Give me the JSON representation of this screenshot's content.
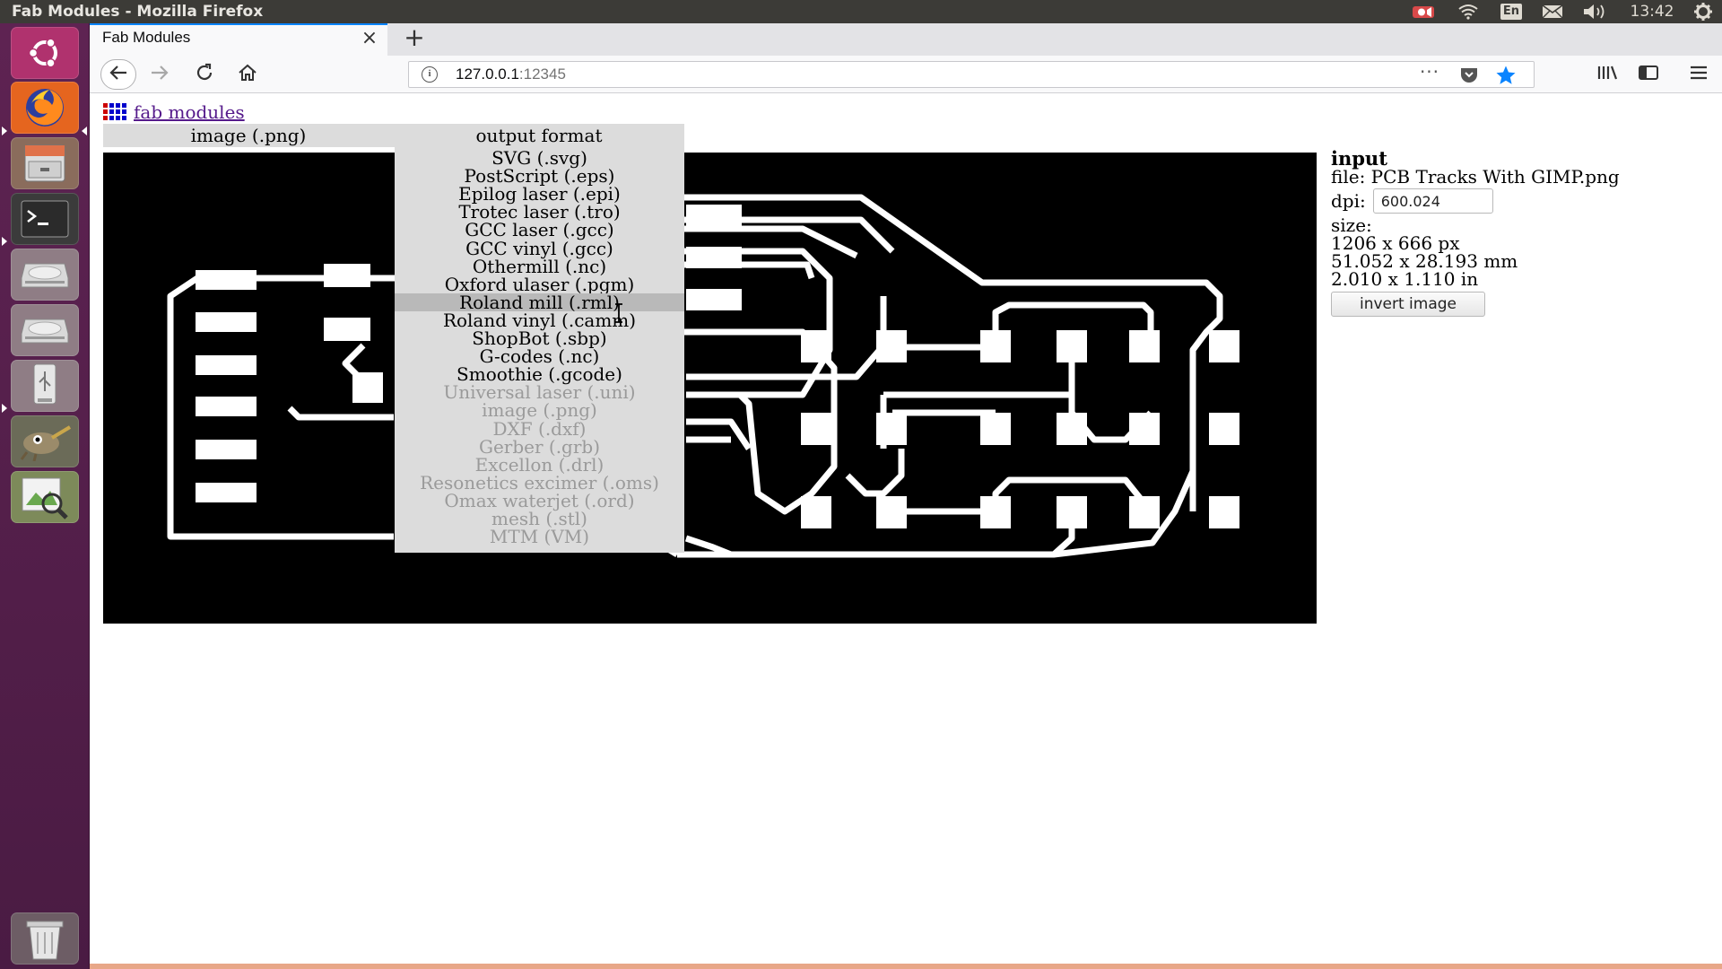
{
  "system": {
    "window_title": "Fab Modules - Mozilla Firefox",
    "keyboard_layout": "En",
    "clock": "13:42"
  },
  "launcher": {
    "items": [
      {
        "name": "ubuntu-dash",
        "icon": "ubuntu-logo-icon"
      },
      {
        "name": "firefox",
        "icon": "firefox-icon"
      },
      {
        "name": "files",
        "icon": "file-cabinet-icon"
      },
      {
        "name": "terminal",
        "icon": "terminal-icon"
      },
      {
        "name": "drive-1",
        "icon": "hard-drive-icon"
      },
      {
        "name": "drive-2",
        "icon": "hard-drive-icon"
      },
      {
        "name": "usb",
        "icon": "usb-drive-icon"
      },
      {
        "name": "gimp",
        "icon": "gimp-icon"
      },
      {
        "name": "image-viewer",
        "icon": "image-viewer-icon"
      },
      {
        "name": "trash",
        "icon": "trash-icon"
      }
    ]
  },
  "browser": {
    "tab_title": "Fab Modules",
    "tab_close": "×",
    "new_tab": "+",
    "url_host": "127.0.0.1",
    "url_port": ":12345",
    "page_actions": "···"
  },
  "page": {
    "home_link": "fab modules",
    "input_format": "image (.png)",
    "output_format": "output format",
    "output_options": [
      {
        "label": "SVG (.svg)",
        "enabled": true
      },
      {
        "label": "PostScript (.eps)",
        "enabled": true
      },
      {
        "label": "Epilog laser (.epi)",
        "enabled": true
      },
      {
        "label": "Trotec laser (.tro)",
        "enabled": true
      },
      {
        "label": "GCC laser (.gcc)",
        "enabled": true
      },
      {
        "label": "GCC vinyl (.gcc)",
        "enabled": true
      },
      {
        "label": "Othermill (.nc)",
        "enabled": true
      },
      {
        "label": "Oxford ulaser (.pgm)",
        "enabled": true
      },
      {
        "label": "Roland mill (.rml)",
        "enabled": true,
        "highlighted": true
      },
      {
        "label": "Roland vinyl (.camm)",
        "enabled": true
      },
      {
        "label": "ShopBot (.sbp)",
        "enabled": true
      },
      {
        "label": "G-codes (.nc)",
        "enabled": true
      },
      {
        "label": "Smoothie (.gcode)",
        "enabled": true
      },
      {
        "label": "Universal laser (.uni)",
        "enabled": false
      },
      {
        "label": "image (.png)",
        "enabled": false
      },
      {
        "label": "DXF (.dxf)",
        "enabled": false
      },
      {
        "label": "Gerber (.grb)",
        "enabled": false
      },
      {
        "label": "Excellon (.drl)",
        "enabled": false
      },
      {
        "label": "Resonetics excimer (.oms)",
        "enabled": false
      },
      {
        "label": "Omax waterjet (.ord)",
        "enabled": false
      },
      {
        "label": "mesh (.stl)",
        "enabled": false
      },
      {
        "label": "MTM (VM)",
        "enabled": false
      }
    ],
    "input_panel": {
      "heading": "input",
      "file": "file: PCB Tracks With GIMP.png",
      "dpi_label": "dpi:",
      "dpi_value": "600.024",
      "size_label": "size:",
      "size_px": "1206 x 666 px",
      "size_mm": "51.052 x 28.193 mm",
      "size_in": "2.010 x 1.110 in",
      "invert_button": "invert image"
    }
  },
  "colors": {
    "launcher_bg": "#5e2352",
    "top_panel_bg": "#3c3b37",
    "link_visited": "#551a8b",
    "accent_blue": "#0a84ff",
    "menu_bg": "#dcdcdc",
    "menu_highlight": "#b9b9b9",
    "grid_icon": [
      "#cc0000",
      "#0000cc"
    ]
  }
}
